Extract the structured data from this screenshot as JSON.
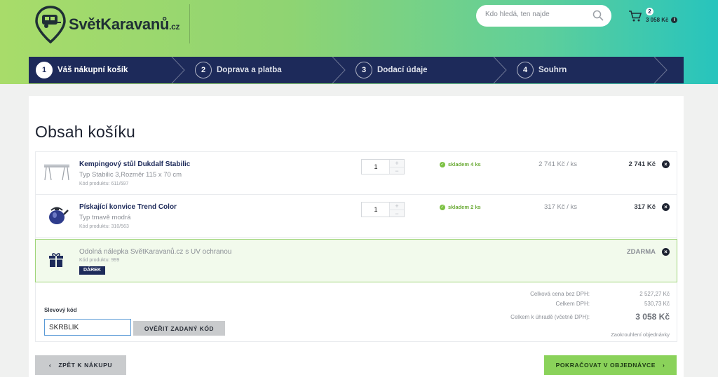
{
  "header": {
    "logo": {
      "name": "SvětKaravanů",
      "tld": ".cz"
    },
    "search": {
      "placeholder": "Kdo hledá, ten najde",
      "value": ""
    },
    "cart": {
      "count": "2",
      "total": "3 058 Kč"
    }
  },
  "steps": [
    {
      "num": "1",
      "label": "Váš nákupní košík",
      "active": true
    },
    {
      "num": "2",
      "label": "Doprava a platba",
      "active": false
    },
    {
      "num": "3",
      "label": "Dodací údaje",
      "active": false
    },
    {
      "num": "4",
      "label": "Souhrn",
      "active": false
    }
  ],
  "main": {
    "title": "Obsah košíku",
    "items": [
      {
        "name": "Kempingový stůl Dukdalf Stabilic",
        "variant": "Typ Stabilic 3,Rozměr 115 x 70 cm",
        "code": "Kód produktu: 611/697",
        "qty": "1",
        "stock": "skladem 4 ks",
        "unit_price": "2 741 Kč / ks",
        "total": "2 741 Kč",
        "icon": "table-icon"
      },
      {
        "name": "Pískající konvice Trend Color",
        "variant": "Typ tmavě modrá",
        "code": "Kód produktu: 310/563",
        "qty": "1",
        "stock": "skladem 2 ks",
        "unit_price": "317 Kč / ks",
        "total": "317 Kč",
        "icon": "kettle-icon"
      }
    ],
    "gift": {
      "name": "Odolná nálepka SvětKaravanů.cz s UV ochranou",
      "code": "Kód produktu: 999",
      "tag": "DÁREK",
      "price": "ZDARMA",
      "icon": "gift-icon"
    },
    "discount": {
      "label": "Slevový kód",
      "value": "SKRBLÍK",
      "button": "OVĚŘIT ZADANÝ KÓD"
    },
    "summary": {
      "without_vat_label": "Celková cena bez DPH:",
      "without_vat": "2 527,27 Kč",
      "vat_label": "Celkem DPH:",
      "vat": "530,73 Kč",
      "total_label": "Celkem k úhradě (včetně DPH):",
      "total": "3 058 Kč",
      "rounding": "Zaokrouhlení objednávky"
    }
  },
  "footer": {
    "back": "ZPĚT K NÁKUPU",
    "next": "POKRAČOVAT V OBJEDNÁVCE"
  },
  "colors": {
    "navy": "#1d2a5a",
    "green": "#8ad25a",
    "gift_bg": "#f2faec"
  }
}
